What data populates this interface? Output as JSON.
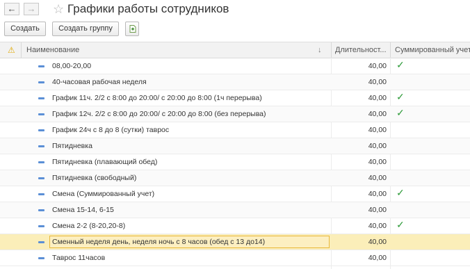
{
  "window": {
    "title": "Графики работы сотрудников",
    "back_glyph": "←",
    "forward_glyph": "→",
    "star_glyph": "☆"
  },
  "toolbar": {
    "create_label": "Создать",
    "create_group_label": "Создать группу"
  },
  "table": {
    "columns": {
      "warning_glyph": "⚠",
      "name": "Наименование",
      "sort_glyph": "↓",
      "duration": "Длительност...",
      "summarized": "Суммированный учет"
    },
    "check_glyph": "✓",
    "rows": [
      {
        "name": "08,00-20,00",
        "duration": "40,00",
        "summarized": true
      },
      {
        "name": "40-часовая рабочая неделя",
        "duration": "40,00",
        "summarized": false
      },
      {
        "name": "График 11ч. 2/2 с 8:00 до 20:00/ с 20:00 до 8:00 (1ч перерыва)",
        "duration": "40,00",
        "summarized": true
      },
      {
        "name": "График 12ч. 2/2 с 8:00 до 20:00/ с 20:00 до 8:00 (без перерыва)",
        "duration": "40,00",
        "summarized": true
      },
      {
        "name": "График 24ч с 8 до 8 (сутки) таврос",
        "duration": "40,00",
        "summarized": false
      },
      {
        "name": "Пятидневка",
        "duration": "40,00",
        "summarized": false
      },
      {
        "name": "Пятидневка (плавающий обед)",
        "duration": "40,00",
        "summarized": false
      },
      {
        "name": "Пятидневка (свободный)",
        "duration": "40,00",
        "summarized": false
      },
      {
        "name": "Смена (Суммированный учет)",
        "duration": "40,00",
        "summarized": true
      },
      {
        "name": "Смена 15-14, 6-15",
        "duration": "40,00",
        "summarized": false
      },
      {
        "name": "Смена 2-2 (8-20,20-8)",
        "duration": "40,00",
        "summarized": true
      },
      {
        "name": "Сменный неделя день, неделя ночь с 8 часов (обед с 13 до14)",
        "duration": "40,00",
        "summarized": false,
        "selected": true
      },
      {
        "name": "Таврос 11часов",
        "duration": "40,00",
        "summarized": false
      }
    ]
  },
  "colors": {
    "check": "#2f9b3a",
    "selected_row": "#fbeeb9",
    "selected_border": "#e8b83d",
    "item_icon": "#5b8fd6"
  }
}
